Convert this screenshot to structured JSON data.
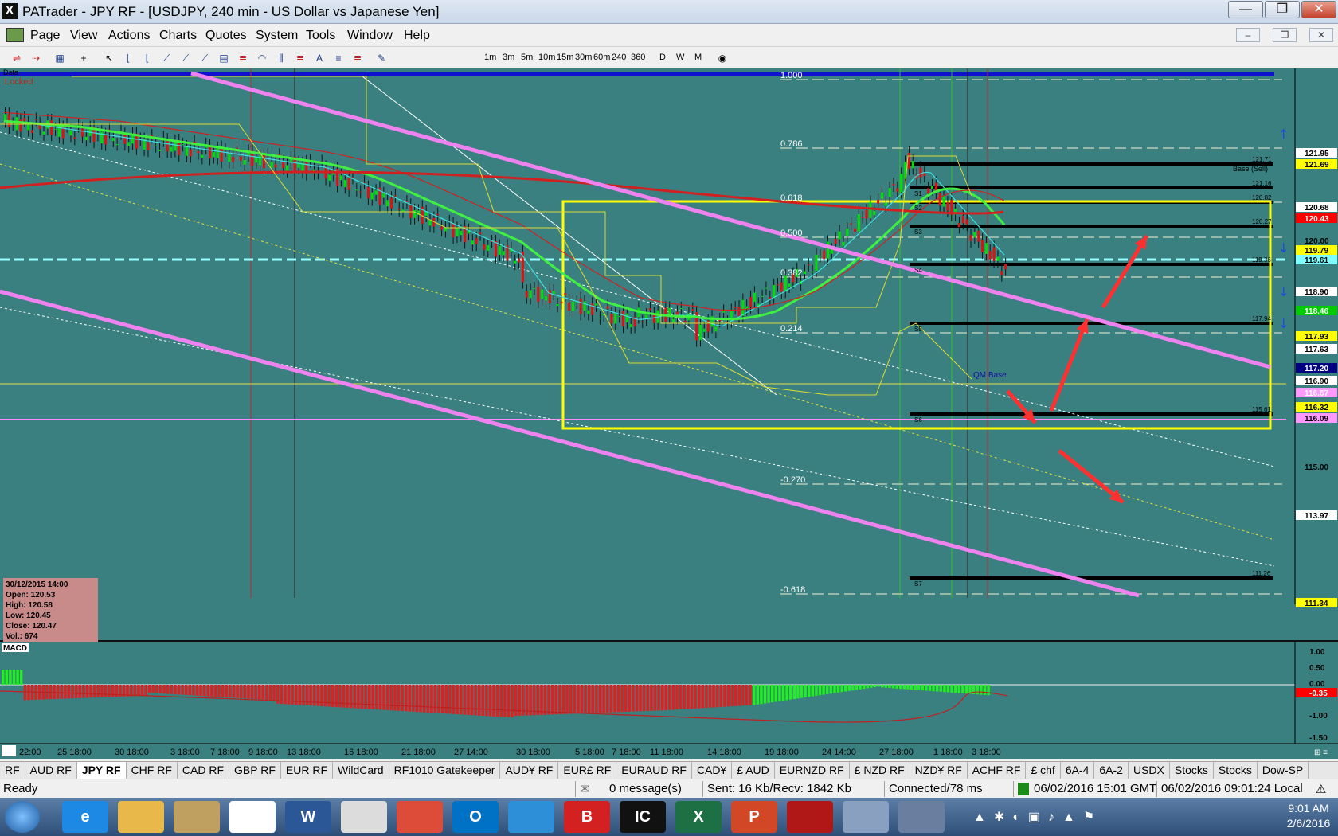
{
  "window": {
    "title": "PATrader - JPY RF - [USDJPY, 240 min - US Dollar vs Japanese Yen]",
    "app_icon": "X",
    "buttons": [
      "minimize-icon",
      "restore-icon",
      "close-icon"
    ]
  },
  "menu": {
    "items": [
      "Page",
      "View",
      "Actions",
      "Charts",
      "Quotes",
      "System",
      "Tools",
      "Window",
      "Help"
    ]
  },
  "toolbar": {
    "timeframes": [
      "1m",
      "3m",
      "5m",
      "10m",
      "15m",
      "30m",
      "60m",
      "240",
      "360"
    ],
    "periods": [
      "D",
      "W",
      "M"
    ]
  },
  "chart": {
    "data_label": "Data",
    "locked_label": "Locked",
    "index_label": "INDEX",
    "base_label": "Base (Sell)",
    "qm_label": "QM Base",
    "fib_labels": [
      "1.000",
      "0.786",
      "0.618",
      "0.500",
      "0.382",
      "0.214",
      "-0.270",
      "-0.618"
    ],
    "pivot_labels": [
      "S1",
      "S2",
      "S3",
      "S4",
      "S5",
      "S6",
      "S7"
    ],
    "pivot_values": [
      "121.71",
      "121.16",
      "120.82",
      "120.27",
      "119.36",
      "117.94",
      "115.61",
      "111.26"
    ],
    "price_scale": [
      {
        "label": "121.95",
        "bg": "#ffffff",
        "fg": "#000000"
      },
      {
        "label": "121.69",
        "bg": "#ffff00",
        "fg": "#000000"
      },
      {
        "label": "120.68",
        "bg": "#ffffff",
        "fg": "#000000"
      },
      {
        "label": "120.43",
        "bg": "#ff0000",
        "fg": "#ffffff"
      },
      {
        "label": "120.00",
        "bg": "",
        "fg": "#000000"
      },
      {
        "label": "119.79",
        "bg": "#ffff00",
        "fg": "#000000"
      },
      {
        "label": "119.61",
        "bg": "#7fffff",
        "fg": "#000000"
      },
      {
        "label": "118.90",
        "bg": "#ffffff",
        "fg": "#000000"
      },
      {
        "label": "118.46",
        "bg": "#00cc00",
        "fg": "#ffffff"
      },
      {
        "label": "117.93",
        "bg": "#ffff00",
        "fg": "#000000"
      },
      {
        "label": "117.63",
        "bg": "#ffffff",
        "fg": "#000000"
      },
      {
        "label": "117.20",
        "bg": "#000080",
        "fg": "#ffffff"
      },
      {
        "label": "116.90",
        "bg": "#ffffff",
        "fg": "#000000"
      },
      {
        "label": "116.67",
        "bg": "#ff99ff",
        "fg": "#ffffff"
      },
      {
        "label": "116.32",
        "bg": "#ffff00",
        "fg": "#000000"
      },
      {
        "label": "116.09",
        "bg": "#ff99ff",
        "fg": "#000000"
      },
      {
        "label": "115.00",
        "bg": "",
        "fg": "#000000"
      },
      {
        "label": "113.97",
        "bg": "#ffffff",
        "fg": "#000000"
      },
      {
        "label": "111.34",
        "bg": "#ffff00",
        "fg": "#000000"
      }
    ],
    "ohlc": {
      "date": "30/12/2015 14:00",
      "open": "Open: 120.53",
      "high": "High: 120.58",
      "low": "Low: 120.45",
      "close": "Close: 120.47",
      "vol": "Vol.: 674"
    },
    "macd": {
      "label": "MACD",
      "scale": [
        "1.00",
        "0.50",
        "0.00",
        "-0.35",
        "-1.00",
        "-1.50"
      ]
    },
    "x_labels": [
      "22:00",
      "25 18:00",
      "30 18:00",
      "3 18:00",
      "7 18:00",
      "9 18:00",
      "13 18:00",
      "16 18:00",
      "21 18:00",
      "27 14:00",
      "30 18:00",
      "5 18:00",
      "7 18:00",
      "11 18:00",
      "14 18:00",
      "19 18:00",
      "24 14:00",
      "27 18:00",
      "1 18:00",
      "3 18:00"
    ],
    "colors": {
      "background": "#3b8080",
      "bull": "#00e000",
      "bear": "#e01010",
      "channel": "#ee82ee",
      "box": "#ffff00"
    }
  },
  "tabs": {
    "items": [
      "RF",
      "AUD RF",
      "JPY RF",
      "CHF RF",
      "CAD RF",
      "GBP RF",
      "EUR RF",
      "WildCard",
      "RF1010 Gatekeeper",
      "AUD¥ RF",
      "EUR£ RF",
      "EURAUD RF",
      "CAD¥",
      "£ AUD",
      "EURNZD RF",
      "£ NZD RF",
      "NZD¥ RF",
      "ACHF RF",
      "£ chf",
      "6A-4",
      "6A-2",
      "USDX",
      "Stocks",
      "Stocks",
      "Dow-SP"
    ],
    "active": "JPY RF"
  },
  "status": {
    "ready": "Ready",
    "messages": "0 message(s)",
    "traffic": "Sent: 16 Kb/Recv: 1842 Kb",
    "connection": "Connected/78 ms",
    "gmt": "06/02/2016 15:01 GMT",
    "local": "06/02/2016 09:01:24 Local"
  },
  "taskbar": {
    "apps": [
      {
        "name": "windows-start-icon",
        "label": "",
        "color": "#2a6ab0"
      },
      {
        "name": "internet-explorer-icon",
        "label": "e",
        "color": "#1e88e5"
      },
      {
        "name": "file-explorer-icon",
        "label": "",
        "color": "#e8b84a"
      },
      {
        "name": "calculator-icon",
        "label": "",
        "color": "#c0a060"
      },
      {
        "name": "blank-window-icon",
        "label": "",
        "color": "#ffffff"
      },
      {
        "name": "word-icon",
        "label": "W",
        "color": "#2b5797"
      },
      {
        "name": "patrader-icon",
        "label": "",
        "color": "#dcdcdc"
      },
      {
        "name": "chrome-icon",
        "label": "",
        "color": "#dd4b39"
      },
      {
        "name": "outlook-icon",
        "label": "O",
        "color": "#0072c6"
      },
      {
        "name": "dropbox-icon",
        "label": "",
        "color": "#2e8fd9"
      },
      {
        "name": "b-app-icon",
        "label": "B",
        "color": "#d32020"
      },
      {
        "name": "ic-app-icon",
        "label": "IC",
        "color": "#111111"
      },
      {
        "name": "excel-icon",
        "label": "X",
        "color": "#1d7044"
      },
      {
        "name": "powerpoint-icon",
        "label": "P",
        "color": "#d24726"
      },
      {
        "name": "red-bird-icon",
        "label": "",
        "color": "#b01818"
      },
      {
        "name": "network-icon",
        "label": "",
        "color": "#8aa0c0"
      },
      {
        "name": "people-icon",
        "label": "",
        "color": "#6a7fa0"
      }
    ],
    "time": "9:01 AM",
    "date": "2/6/2016"
  }
}
